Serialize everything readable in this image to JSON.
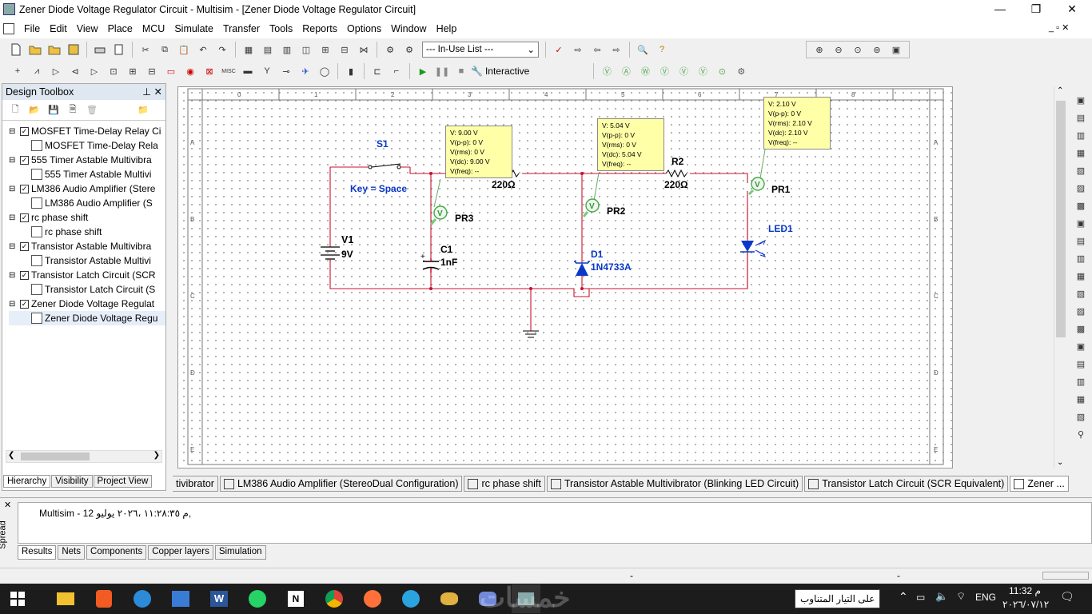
{
  "window": {
    "title": "Zener Diode Voltage Regulator Circuit - Multisim - [Zener Diode Voltage Regulator Circuit]"
  },
  "menu": [
    "File",
    "Edit",
    "View",
    "Place",
    "MCU",
    "Simulate",
    "Transfer",
    "Tools",
    "Reports",
    "Options",
    "Window",
    "Help"
  ],
  "toolbar": {
    "in_use_list": "--- In-Use List ---",
    "interactive_label": "Interactive"
  },
  "design_toolbox": {
    "title": "Design Toolbox",
    "items": [
      {
        "label": "MOSFET Time-Delay Relay Ci",
        "child": "MOSFET Time-Delay Rela"
      },
      {
        "label": "555 Timer Astable Multivibra",
        "child": "555 Timer Astable Multivi"
      },
      {
        "label": "LM386 Audio Amplifier (Stere",
        "child": "LM386 Audio Amplifier (S"
      },
      {
        "label": "rc phase shift",
        "child": "rc phase shift"
      },
      {
        "label": "Transistor Astable Multivibra",
        "child": "Transistor Astable Multivi"
      },
      {
        "label": "Transistor Latch Circuit (SCR",
        "child": "Transistor Latch Circuit (S"
      },
      {
        "label": "Zener Diode Voltage Regulat",
        "child": "Zener Diode Voltage Regu"
      }
    ],
    "tabs": [
      "Hierarchy",
      "Visibility",
      "Project View"
    ]
  },
  "schematic": {
    "col_labels": [
      "0",
      "1",
      "2",
      "3",
      "4",
      "5",
      "6",
      "7",
      "8"
    ],
    "row_labels": [
      "A",
      "B",
      "C",
      "D",
      "E"
    ],
    "s1": "S1",
    "s1_key": "Key = Space",
    "v1": "V1",
    "v1_val": "9V",
    "c1": "C1",
    "c1_val": "1nF",
    "r1_val": "220Ω",
    "r2": "R2",
    "r2_val": "220Ω",
    "d1": "D1",
    "d1_val": "1N4733A",
    "led1": "LED1",
    "pr1": "PR1",
    "pr2": "PR2",
    "pr3": "PR3",
    "probe_pr3": [
      "V: 9.00 V",
      "V(p-p): 0 V",
      "V(rms): 0 V",
      "V(dc): 9.00 V",
      "V(freq): --"
    ],
    "probe_pr2": [
      "V: 5.04 V",
      "V(p-p): 0 V",
      "V(rms): 0 V",
      "V(dc): 5.04 V",
      "V(freq): --"
    ],
    "probe_pr1": [
      "V: 2.10 V",
      "V(p-p): 0 V",
      "V(rms): 2.10 V",
      "V(dc): 2.10 V",
      "V(freq): --"
    ]
  },
  "doc_tabs": [
    "tivibrator",
    "LM386 Audio Amplifier (StereoDual Configuration)",
    "rc phase shift",
    "Transistor Astable Multivibrator (Blinking LED Circuit)",
    "Transistor Latch Circuit (SCR Equivalent)",
    "Zener ..."
  ],
  "spreadsheet": {
    "side_label": "Spread",
    "result_line": "Multisim  -  12 م ١١:٢٨:٣٥ ،٢٠٢٦ يوليو,",
    "tabs": [
      "Results",
      "Nets",
      "Components",
      "Copper layers",
      "Simulation"
    ]
  },
  "taskbar": {
    "notification": "على التيار المتناوب",
    "lang": "ENG",
    "time": "11:32 م",
    "date": "٢٠٢٦/٠٧/١٢",
    "watermark": "خمسات",
    "apps": [
      "start-icon",
      "file-explorer-icon",
      "brave-icon",
      "edge-icon",
      "store-icon",
      "word-icon",
      "whatsapp-icon",
      "notion-icon",
      "chrome-icon",
      "firefox-icon",
      "telegram-icon",
      "wine-icon",
      "discord-icon",
      "multisim-icon"
    ]
  }
}
